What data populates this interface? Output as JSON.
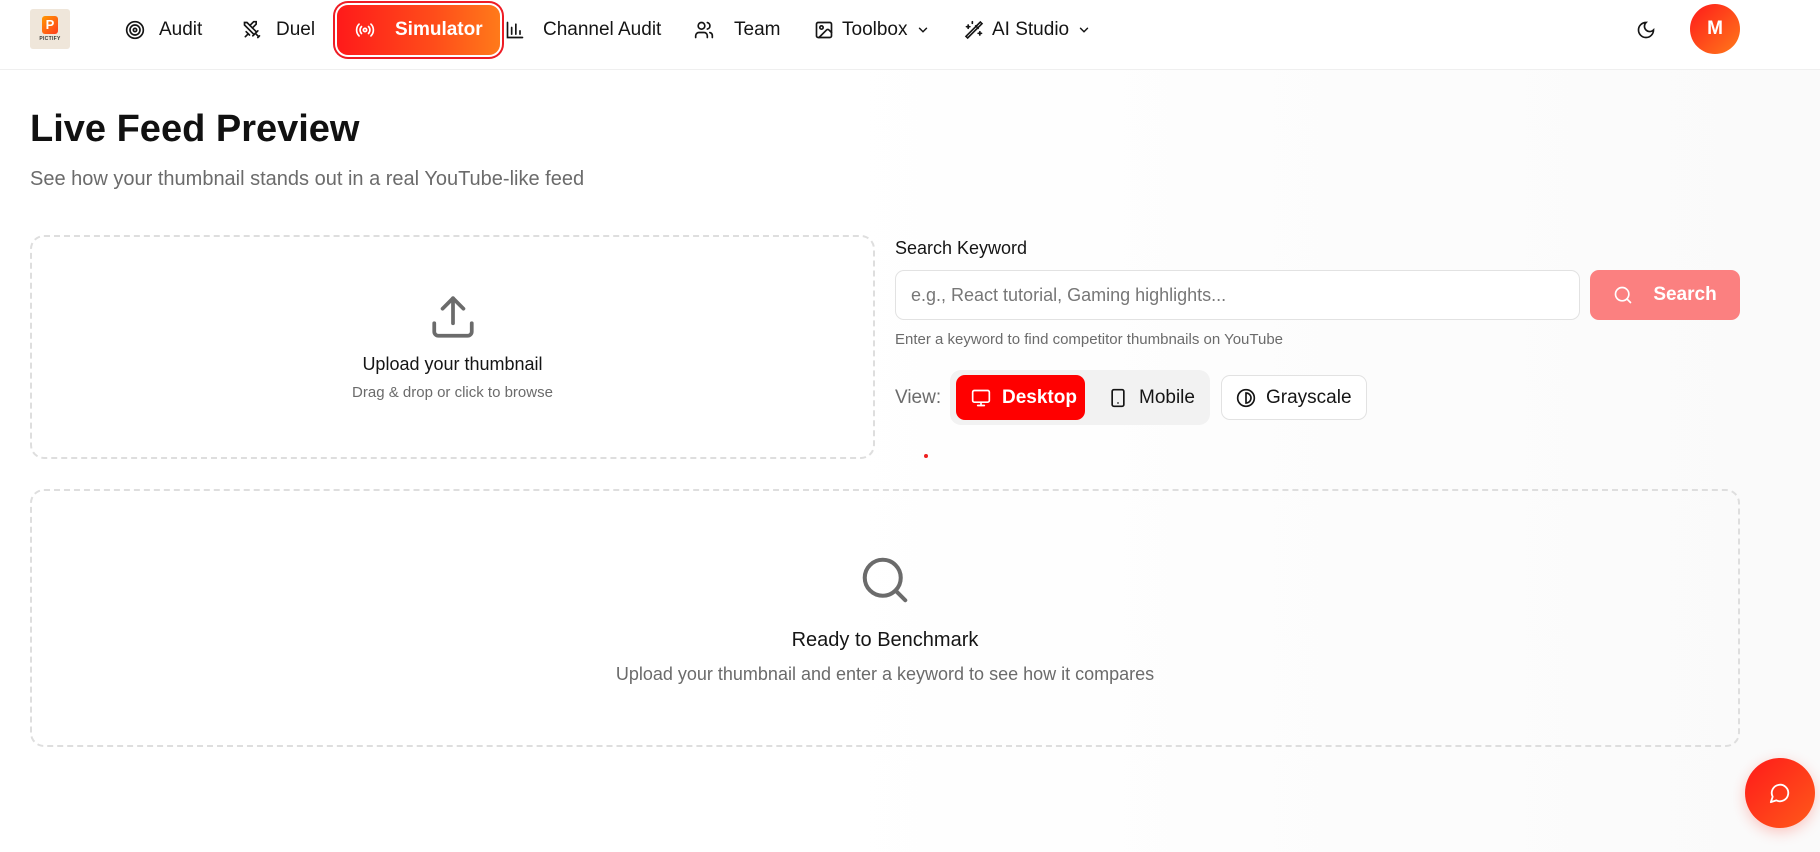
{
  "brand": {
    "logo_letter": "P",
    "logo_word": "PICTIFY"
  },
  "nav": {
    "items": [
      {
        "label": "Audit",
        "icon": "target-icon"
      },
      {
        "label": "Duel",
        "icon": "crossed-swords-icon"
      },
      {
        "label": "Simulator",
        "icon": "broadcast-icon",
        "active": true
      },
      {
        "label": "Channel Audit",
        "icon": "bar-chart-icon"
      },
      {
        "label": "Team",
        "icon": "users-icon"
      },
      {
        "label": "Toolbox",
        "icon": "image-tool-icon",
        "dropdown": true
      },
      {
        "label": "AI Studio",
        "icon": "magic-wand-icon",
        "dropdown": true
      }
    ],
    "theme_icon": "moon-icon",
    "avatar_initial": "M"
  },
  "header": {
    "title": "Live Feed Preview",
    "subtitle": "See how your thumbnail stands out in a real YouTube-like feed"
  },
  "upload": {
    "icon": "upload-icon",
    "title": "Upload your thumbnail",
    "hint": "Drag & drop or click to browse"
  },
  "search": {
    "label": "Search Keyword",
    "value": "",
    "placeholder": "e.g., React tutorial, Gaming highlights...",
    "button_label": "Search",
    "button_icon": "search-icon",
    "help": "Enter a keyword to find competitor thumbnails on YouTube"
  },
  "view": {
    "label": "View:",
    "options": [
      {
        "label": "Desktop",
        "icon": "monitor-icon",
        "selected": true
      },
      {
        "label": "Mobile",
        "icon": "smartphone-icon",
        "selected": false
      }
    ],
    "grayscale_label": "Grayscale",
    "grayscale_icon": "contrast-icon"
  },
  "empty_state": {
    "icon": "search-icon",
    "title": "Ready to Benchmark",
    "hint": "Upload your thumbnail and enter a keyword to see how it compares"
  },
  "chat": {
    "icon": "chat-bubble-icon"
  },
  "colors": {
    "accent": "#ff0000",
    "accent_gradient_end": "#ff7a1a",
    "search_button": "#fb8080",
    "muted_text": "#6b6b6b",
    "border": "#dedede"
  }
}
